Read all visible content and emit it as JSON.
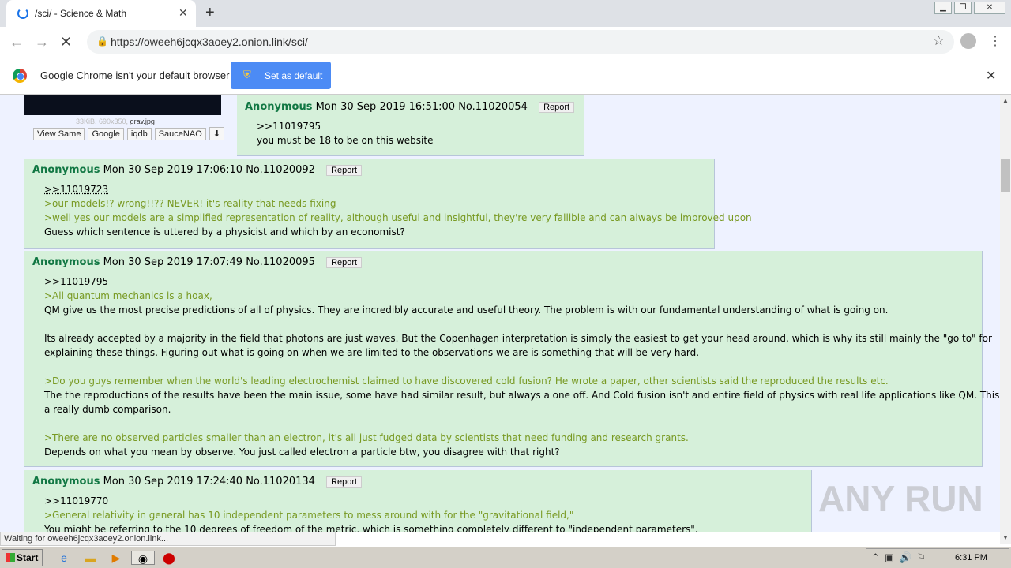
{
  "browser": {
    "tab_title": "/sci/ - Science & Math",
    "url": "https://oweeh6jcqx3aoey2.onion.link/sci/",
    "infobar_message": "Google Chrome isn't your default browser",
    "set_default_label": "Set as default",
    "status_text": "Waiting for oweeh6jcqx3aoey2.onion.link..."
  },
  "image_file": {
    "info": "33KiB, 690x350,",
    "filename": "grav.jpg",
    "search_links": [
      "View Same",
      "Google",
      "iqdb",
      "SauceNAO"
    ]
  },
  "posts": [
    {
      "name": "Anonymous",
      "date": "Mon 30 Sep 2019 16:51:00",
      "no": "No.11020054",
      "report": "Report",
      "lines": [
        {
          "text": ">>11019795",
          "kind": "quote"
        },
        {
          "text": "you must be 18 to be on this website",
          "kind": "text"
        }
      ]
    },
    {
      "name": "Anonymous",
      "date": "Mon 30 Sep 2019 17:06:10",
      "no": "No.11020092",
      "report": "Report",
      "lines": [
        {
          "text": ">>11019723",
          "kind": "quote"
        },
        {
          "text": ">our models!? wrong!!?? NEVER! it's reality that needs fixing",
          "kind": "greentext"
        },
        {
          "text": ">well yes our models are a simplified representation of reality, although useful and insightful, they're very fallible and can always be improved upon",
          "kind": "greentext"
        },
        {
          "text": "Guess which sentence is uttered by a physicist and which by an economist?",
          "kind": "text"
        }
      ]
    },
    {
      "name": "Anonymous",
      "date": "Mon 30 Sep 2019 17:07:49",
      "no": "No.11020095",
      "report": "Report",
      "lines": [
        {
          "text": ">>11019795",
          "kind": "quote"
        },
        {
          "text": ">All quantum mechanics is a hoax,",
          "kind": "greentext"
        },
        {
          "text": "QM give us the most precise predictions of all of physics. They are incredibly accurate and useful theory. The problem is with our fundamental understanding of what is going on.",
          "kind": "text"
        },
        {
          "text": "Its already accepted by a majority in the field that photons are just waves. But the Copenhagen interpretation is simply the easiest to get your head around, which is why its still mainly the \"go to\" for",
          "kind": "text"
        },
        {
          "text": "explaining these things. Figuring out what is going on when we are limited to the observations we are is something that will be very hard.",
          "kind": "text"
        },
        {
          "text": ">Do you guys remember when the world's leading electrochemist claimed to have discovered cold fusion? He wrote a paper, other scientists said the reproduced the results etc.",
          "kind": "greentext"
        },
        {
          "text": "The the reproductions of the results have been the main issue, some have had similar result, but always a one off. And Cold fusion isn't and entire field of physics with real life applications like QM. This is",
          "kind": "text"
        },
        {
          "text": "a really dumb comparison.",
          "kind": "text"
        },
        {
          "text": ">There are no observed particles smaller than an electron, it's all just fudged data by scientists that need funding and research grants.",
          "kind": "greentext"
        },
        {
          "text": "Depends on what you mean by observe. You just called electron a particle btw, you disagree with that right?",
          "kind": "text"
        }
      ]
    },
    {
      "name": "Anonymous",
      "date": "Mon 30 Sep 2019 17:24:40",
      "no": "No.11020134",
      "report": "Report",
      "lines": [
        {
          "text": ">>11019770",
          "kind": "quote"
        },
        {
          "text": ">General relativity in general has 10 independent parameters to mess around with for the \"gravitational field,\"",
          "kind": "greentext"
        },
        {
          "text": "You might be referring to the 10 degrees of freedom of the metric, which is something completely different to \"independent parameters\".",
          "kind": "text"
        }
      ]
    }
  ],
  "watermark": "ANY RUN",
  "taskbar": {
    "start_label": "Start",
    "clock": "6:31 PM"
  },
  "colors": {
    "reply_bg": "#d6f0da",
    "name_green": "#117743",
    "greentext": "#789922",
    "set_default_blue": "#4c8bf5"
  }
}
